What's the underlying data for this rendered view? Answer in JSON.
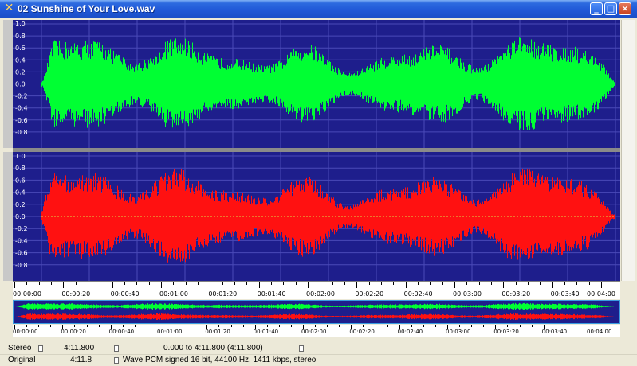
{
  "window": {
    "title": "02 Sunshine of Your Love.wav",
    "icon": "waveform-app-icon",
    "controls": {
      "minimize": "_",
      "maximize": "□",
      "close": "×"
    }
  },
  "channels": [
    {
      "name": "left",
      "color": "#00ff33",
      "scale": [
        "1.0",
        "0.8",
        "0.6",
        "0.4",
        "0.2",
        "0.0",
        "-0.2",
        "-0.4",
        "-0.6",
        "-0.8"
      ]
    },
    {
      "name": "right",
      "color": "#ff1111",
      "scale": [
        "1.0",
        "0.8",
        "0.6",
        "0.4",
        "0.2",
        "0.0",
        "-0.2",
        "-0.4",
        "-0.6",
        "-0.8"
      ]
    }
  ],
  "colors": {
    "background": "#1e1e8c",
    "grid": "#4a4ab8",
    "left": "#00ff33",
    "right": "#ff1111"
  },
  "timeline": [
    "00:00:00",
    "00:00:20",
    "00:00:40",
    "00:01:00",
    "00:01:20",
    "00:01:40",
    "00:02:00",
    "00:02:20",
    "00:02:40",
    "00:03:00",
    "00:03:20",
    "00:03:40",
    "00:04:00"
  ],
  "overview_timeline": [
    "00:00:00",
    "00:00:20",
    "00:00:40",
    "00:01:00",
    "00:01:20",
    "00:01:40",
    "00:02:00",
    "00:02:20",
    "00:02:40",
    "00:03:00",
    "00:03:20",
    "00:03:40",
    "00:04:00"
  ],
  "status": {
    "row1": {
      "label": "Stereo",
      "length": "4:11.800",
      "selection": "0.000 to 4:11.800 (4:11.800)"
    },
    "row2": {
      "label": "Original",
      "length": "4:11.8",
      "format": "Wave PCM signed 16 bit, 44100 Hz, 1411 kbps, stereo"
    }
  }
}
